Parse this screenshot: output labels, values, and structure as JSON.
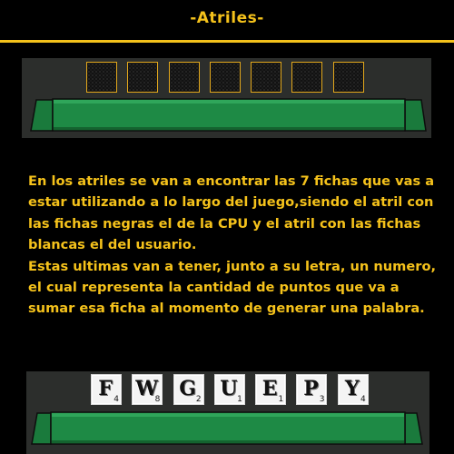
{
  "header": {
    "title": "-Atriles-"
  },
  "cpu_rack": {
    "tile_count": 7
  },
  "description": {
    "paragraph1": "En los atriles se van a encontrar las 7 fichas que vas a estar utilizando a lo largo del juego,siendo el atril con las fichas negras el de la CPU y el atril con las fichas blancas el del usuario.",
    "paragraph2": "Estas ultimas van a tener, junto a su letra, un numero, el cual representa la cantidad de puntos que va a sumar esa ficha al momento de generar una palabra."
  },
  "user_rack": {
    "tiles": [
      {
        "letter": "F",
        "points": "4"
      },
      {
        "letter": "W",
        "points": "8"
      },
      {
        "letter": "G",
        "points": "2"
      },
      {
        "letter": "U",
        "points": "1"
      },
      {
        "letter": "E",
        "points": "1"
      },
      {
        "letter": "P",
        "points": "3"
      },
      {
        "letter": "Y",
        "points": "4"
      }
    ]
  },
  "colors": {
    "accent": "#f5c21b",
    "rack_green": "#1e8a45",
    "rack_background": "#2c2e2c"
  }
}
